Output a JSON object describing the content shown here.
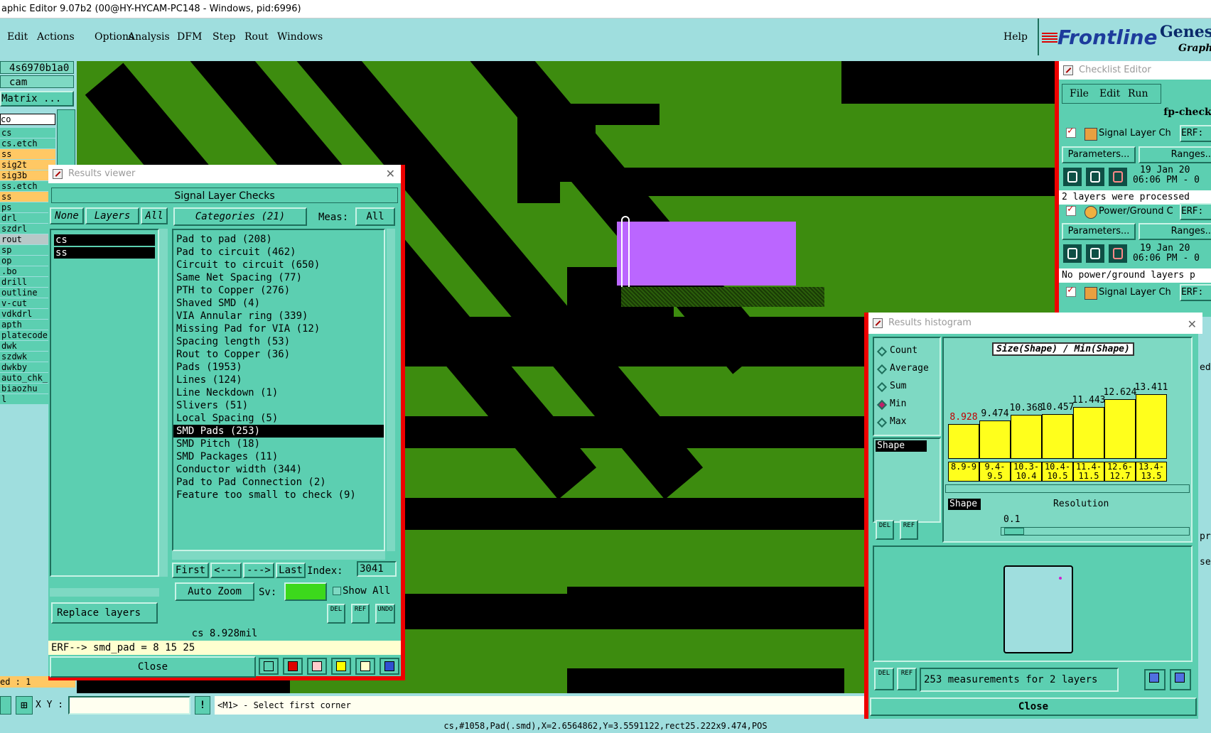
{
  "titlebar": {
    "text": "aphic Editor 9.07b2 (00@HY-HYCAM-PC148 - Windows, pid:6996)"
  },
  "menu": {
    "items": [
      "Edit",
      "Actions",
      "Options",
      "Analysis",
      "DFM",
      "Step",
      "Rout",
      "Windows"
    ],
    "help": "Help"
  },
  "brand": {
    "logo": "Frontline",
    "product": "Genesis",
    "subtitle": "Graphic"
  },
  "left_panel": {
    "job": "4s6970b1a0",
    "step": "cam",
    "matrix_button": "Matrix ...",
    "combo": "co",
    "layers": [
      {
        "name": "cs",
        "style": "teal"
      },
      {
        "name": "cs.etch",
        "style": "teal"
      },
      {
        "name": "ss",
        "style": "orange"
      },
      {
        "name": "sig2t",
        "style": "orange"
      },
      {
        "name": "sig3b",
        "style": "orange"
      },
      {
        "name": "ss.etch",
        "style": "teal"
      },
      {
        "name": "ss",
        "style": "orange"
      },
      {
        "name": "ps",
        "style": "teal"
      },
      {
        "name": "drl",
        "style": "teal"
      },
      {
        "name": "szdrl",
        "style": "teal"
      },
      {
        "name": "rout",
        "style": "gray"
      },
      {
        "name": "sp",
        "style": "teal"
      },
      {
        "name": "op",
        "style": "teal"
      },
      {
        "name": ".bo",
        "style": "teal"
      },
      {
        "name": "drill",
        "style": "teal"
      },
      {
        "name": "outline",
        "style": "teal"
      },
      {
        "name": "v-cut",
        "style": "teal"
      },
      {
        "name": "vdkdrl",
        "style": "teal"
      },
      {
        "name": "apth",
        "style": "teal"
      },
      {
        "name": "platecode-t",
        "style": "teal"
      },
      {
        "name": "dwk",
        "style": "teal"
      },
      {
        "name": "szdwk",
        "style": "teal"
      },
      {
        "name": "dwkby",
        "style": "teal"
      },
      {
        "name": "auto_chk_p",
        "style": "teal"
      },
      {
        "name": "biaozhu",
        "style": "teal"
      },
      {
        "name": "l",
        "style": "teal"
      }
    ],
    "selected_status": "ed : 1"
  },
  "results_viewer": {
    "title": "Results viewer",
    "header": "Signal Layer Checks",
    "none_btn": "None",
    "layers_btn": "Layers",
    "all_btn": "All",
    "layers": [
      "cs",
      "ss"
    ],
    "categories_label": "Categories (21)",
    "meas_label": "Meas:",
    "meas_value": "All",
    "categories": [
      "Pad to pad (208)",
      "Pad to circuit (462)",
      "Circuit to circuit (650)",
      "Same Net Spacing (77)",
      "PTH to Copper (276)",
      "Shaved SMD (4)",
      "VIA Annular ring (339)",
      "Missing Pad for VIA (12)",
      "Spacing length (53)",
      "Rout to Copper (36)",
      "Pads (1953)",
      "Lines (124)",
      "Line Neckdown (1)",
      "Slivers (51)",
      "Local Spacing (5)",
      "SMD Pads (253)",
      "SMD Pitch (18)",
      "SMD Packages (11)",
      "Conductor width (344)",
      "Pad to Pad Connection (2)",
      "Feature too small to check (9)"
    ],
    "selected_category": 15,
    "first_btn": "First",
    "prev_btn": "<---",
    "next_btn": "--->",
    "last_btn": "Last",
    "index_label": "Index:",
    "index_value": "3041",
    "auto_zoom": "Auto Zoom",
    "sv_label": "Sv:",
    "show_all": "Show All",
    "replace_layers": "Replace layers",
    "del": "DEL",
    "ref": "REF",
    "undo": "UNDO",
    "value_line": "cs 8.928mil",
    "erf_line": "ERF--> smd_pad = 8 15 25",
    "close": "Close"
  },
  "checklist": {
    "title": "Checklist Editor",
    "menu": [
      "File",
      "Edit",
      "Run"
    ],
    "name": "fp-checkl",
    "items": [
      {
        "label": "Signal Layer Ch",
        "erf": "ERF:",
        "params": "Parameters...",
        "ranges": "Ranges...",
        "date": "19 Jan 20",
        "time": "06:06 PM - 0",
        "status": "2 layers were processed"
      },
      {
        "label": "Power/Ground C",
        "erf": "ERF:",
        "params": "Parameters...",
        "ranges": "Ranges...",
        "date": "19 Jan 20",
        "time": "06:06 PM - 0",
        "status": "No power/ground layers p"
      },
      {
        "label": "Signal Layer Ch",
        "erf": "ERF:"
      }
    ]
  },
  "histogram": {
    "title": "Results histogram",
    "modes": [
      "Count",
      "Average",
      "Sum",
      "Min",
      "Max"
    ],
    "selected_mode": "Min",
    "chart_title": "Size(Shape) / Min(Shape)",
    "shape_label": "Shape",
    "resolution_label": "Resolution",
    "resolution_value": "0.1",
    "del": "DEL",
    "ref": "REF",
    "summary": "253 measurements for 2 layers",
    "close": "Close"
  },
  "chart_data": {
    "type": "bar",
    "title": "Size(Shape) / Min(Shape)",
    "categories": [
      "8.9-9",
      "9.4-9.5",
      "10.3-10.4",
      "10.4-10.5",
      "11.4-11.5",
      "12.6-12.7",
      "13.4-13.5"
    ],
    "values": [
      8.928,
      9.474,
      10.368,
      10.457,
      11.443,
      12.624,
      13.411
    ],
    "value_labels": [
      "8.928",
      "9.474",
      "10.368",
      "10.457",
      "11.443",
      "12.624",
      "13.411"
    ],
    "highlight_index": 0,
    "highlight_color": "#c00000",
    "bar_color": "#ffff1c"
  },
  "side_labels": {
    "ed": "ed",
    "pro": "pro",
    "se": "se"
  },
  "bottom": {
    "xy_label": "X Y :",
    "prompt": "<M1> - Select first corner",
    "status": "cs,#1058,Pad(.smd),X=2.6564862,Y=3.5591122,rect25.222x9.474,POS"
  },
  "colors": {
    "copper": "#3d8c0f",
    "selected": "#bb66ff",
    "panel": "#5ccfb1",
    "accent_red": "#e00000"
  }
}
